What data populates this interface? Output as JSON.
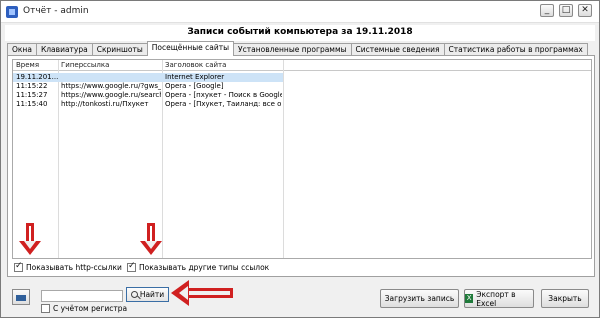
{
  "window": {
    "title": "Отчёт - admin",
    "controls": {
      "minimize": "_",
      "maximize": "□",
      "close": "✕"
    }
  },
  "header": {
    "title": "Записи событий компьютера за 19.11.2018"
  },
  "tabs": [
    "Окна",
    "Клавиатура",
    "Скриншоты",
    "Посещённые сайты",
    "Установленные программы",
    "Системные сведения",
    "Статистика работы в программах"
  ],
  "active_tab": "Посещённые сайты",
  "table": {
    "columns": [
      "Время",
      "Гиперссылка",
      "Заголовок сайта"
    ],
    "rows": [
      {
        "time": "19.11.201...",
        "url": "",
        "title": "Internet Explorer"
      },
      {
        "time": "11:15:22",
        "url": "https://www.google.ru/?gws_rd...",
        "title": "Opera - [Google]"
      },
      {
        "time": "11:15:27",
        "url": "https://www.google.ru/search?...",
        "title": "Opera - [пхукет - Поиск в Google]"
      },
      {
        "time": "11:15:40",
        "url": "http://tonkosti.ru/Пхукет",
        "title": "Opera - [Пхукет, Таиланд: все о П..."
      }
    ]
  },
  "checkboxes": {
    "show_http": {
      "label": "Показывать http-ссылки",
      "checked": true
    },
    "show_other": {
      "label": "Показывать другие типы ссылок",
      "checked": true
    },
    "case_sensitive": {
      "label": "С учётом регистра",
      "checked": false
    }
  },
  "search": {
    "value": "",
    "find_label": "Найти"
  },
  "buttons": {
    "load_record": "Загрузить запись",
    "export_excel": "Экспорт в Excel",
    "close": "Закрыть"
  },
  "colors": {
    "annotation_arrow": "#d02020",
    "selection": "#cde3f7"
  }
}
